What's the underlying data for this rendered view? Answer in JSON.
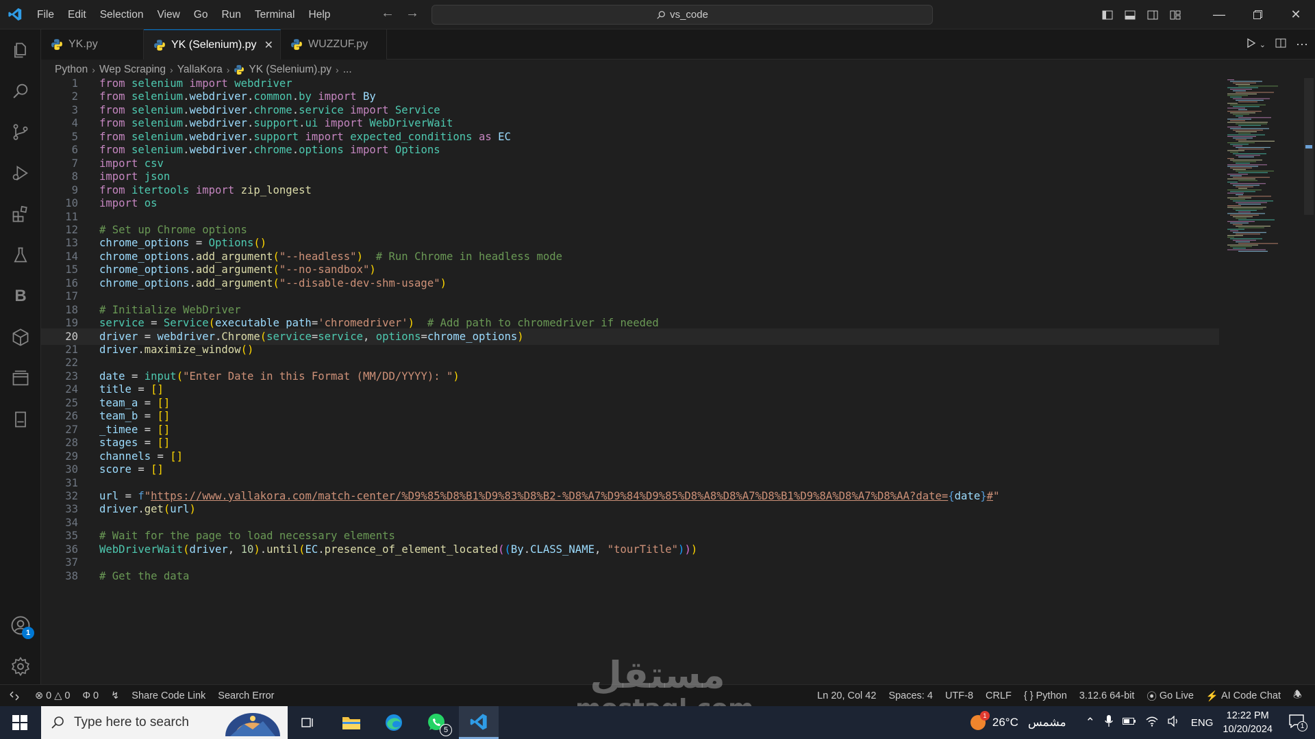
{
  "menu": [
    "File",
    "Edit",
    "Selection",
    "View",
    "Go",
    "Run",
    "Terminal",
    "Help"
  ],
  "command_center": {
    "label": "vs_code"
  },
  "tabs": [
    {
      "label": "YK.py",
      "active": false
    },
    {
      "label": "YK (Selenium).py",
      "active": true
    },
    {
      "label": "WUZZUF.py",
      "active": false
    }
  ],
  "breadcrumb": [
    "Python",
    "Wep Scraping",
    "YallaKora",
    "YK (Selenium).py",
    "..."
  ],
  "activity_badge": "1",
  "activity_b_label": "B",
  "editor": {
    "current_line": 20,
    "lines": [
      "from selenium import webdriver",
      "from selenium.webdriver.common.by import By",
      "from selenium.webdriver.chrome.service import Service",
      "from selenium.webdriver.support.ui import WebDriverWait",
      "from selenium.webdriver.support import expected_conditions as EC",
      "from selenium.webdriver.chrome.options import Options",
      "import csv",
      "import json",
      "from itertools import zip_longest",
      "import os",
      "",
      "# Set up Chrome options",
      "chrome_options = Options()",
      "chrome_options.add_argument(\"--headless\")  # Run Chrome in headless mode",
      "chrome_options.add_argument(\"--no-sandbox\")",
      "chrome_options.add_argument(\"--disable-dev-shm-usage\")",
      "",
      "# Initialize WebDriver",
      "service = Service(executable_path='chromedriver')  # Add path to chromedriver if needed",
      "driver = webdriver.Chrome(service=service, options=chrome_options)",
      "driver.maximize_window()",
      "",
      "date = input(\"Enter Date in this Format (MM/DD/YYYY): \")",
      "title = []",
      "team_a = []",
      "team_b = []",
      "_timee = []",
      "stages = []",
      "channels = []",
      "score = []",
      "",
      "url = f\"https://www.yallakora.com/match-center/%D9%85%D8%B1%D9%83%D8%B2-%D8%A7%D9%84%D9%85%D8%A8%D8%A7%D8%B1%D9%8A%D8%A7%D8%AA?date={date}#\"",
      "driver.get(url)",
      "",
      "# Wait for the page to load necessary elements",
      "WebDriverWait(driver, 10).until(EC.presence_of_element_located((By.CLASS_NAME, \"tourTitle\")))",
      "",
      "# Get the data"
    ]
  },
  "statusbar": {
    "errors": "0",
    "warnings": "0",
    "ports": "0",
    "share_code_link": "Share Code Link",
    "search_error": "Search Error",
    "position": "Ln 20, Col 42",
    "spaces": "Spaces: 4",
    "encoding": "UTF-8",
    "eol": "CRLF",
    "language": "Python",
    "interpreter": "3.12.6 64-bit",
    "go_live": "Go Live",
    "ai_chat": "AI Code Chat"
  },
  "taskbar": {
    "search_placeholder": "Type here to search",
    "whatsapp_badge": "5",
    "weather": "26°C",
    "weather_desc": "مشمس",
    "weather_badge": "1",
    "language": "ENG",
    "time": "12:22 PM",
    "date": "10/20/2024",
    "notification_count": "1"
  },
  "watermark": {
    "arabic": "مستقل",
    "latin": "mostaql.com"
  },
  "colors": {
    "accent": "#0078d4",
    "editor_bg": "#1f1f1f",
    "keyword": "#c586c0",
    "string": "#ce9178",
    "comment": "#6a9955"
  }
}
